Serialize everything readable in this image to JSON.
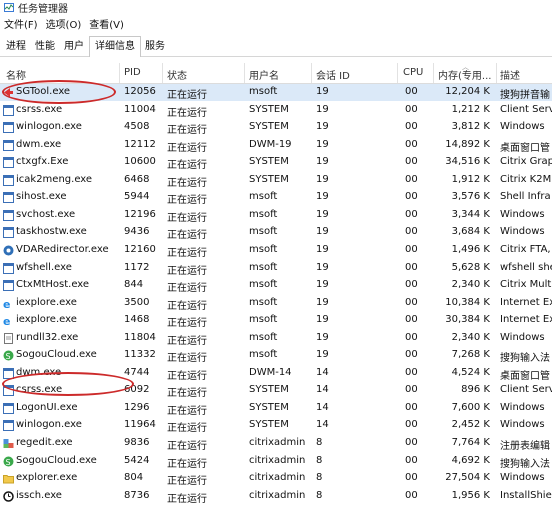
{
  "window": {
    "title": "任务管理器"
  },
  "menu": [
    "文件(F)",
    "选项(O)",
    "查看(V)"
  ],
  "tabs": [
    "进程",
    "性能",
    "用户",
    "详细信息",
    "服务"
  ],
  "columns": [
    "名称",
    "PID",
    "状态",
    "用户名",
    "会话 ID",
    "CPU",
    "内存(专用...",
    "描述"
  ],
  "rows": [
    {
      "name": "SGTool.exe",
      "pid": "12056",
      "status": "正在运行",
      "user": "msoft",
      "session": "19",
      "cpu": "00",
      "mem": "12,204 K",
      "desc": "搜狗拼音输",
      "icon": "red-arrow-icon"
    },
    {
      "name": "csrss.exe",
      "pid": "11004",
      "status": "正在运行",
      "user": "SYSTEM",
      "session": "19",
      "cpu": "00",
      "mem": "1,212 K",
      "desc": "Client Serv",
      "icon": "window-app-icon"
    },
    {
      "name": "winlogon.exe",
      "pid": "4508",
      "status": "正在运行",
      "user": "SYSTEM",
      "session": "19",
      "cpu": "00",
      "mem": "3,812 K",
      "desc": "Windows",
      "icon": "window-app-icon"
    },
    {
      "name": "dwm.exe",
      "pid": "12112",
      "status": "正在运行",
      "user": "DWM-19",
      "session": "19",
      "cpu": "00",
      "mem": "14,892 K",
      "desc": "桌面窗口管",
      "icon": "window-app-icon"
    },
    {
      "name": "ctxgfx.Exe",
      "pid": "10600",
      "status": "正在运行",
      "user": "SYSTEM",
      "session": "19",
      "cpu": "00",
      "mem": "34,516 K",
      "desc": "Citrix Grap",
      "icon": "window-app-icon"
    },
    {
      "name": "icak2meng.exe",
      "pid": "6468",
      "status": "正在运行",
      "user": "SYSTEM",
      "session": "19",
      "cpu": "00",
      "mem": "1,912 K",
      "desc": "Citrix K2M",
      "icon": "window-app-icon"
    },
    {
      "name": "sihost.exe",
      "pid": "5944",
      "status": "正在运行",
      "user": "msoft",
      "session": "19",
      "cpu": "00",
      "mem": "3,576 K",
      "desc": "Shell Infra",
      "icon": "window-app-icon"
    },
    {
      "name": "svchost.exe",
      "pid": "12196",
      "status": "正在运行",
      "user": "msoft",
      "session": "19",
      "cpu": "00",
      "mem": "3,344 K",
      "desc": "Windows",
      "icon": "window-app-icon"
    },
    {
      "name": "taskhostw.exe",
      "pid": "9436",
      "status": "正在运行",
      "user": "msoft",
      "session": "19",
      "cpu": "00",
      "mem": "3,684 K",
      "desc": "Windows",
      "icon": "window-app-icon"
    },
    {
      "name": "VDARedirector.exe",
      "pid": "12160",
      "status": "正在运行",
      "user": "msoft",
      "session": "19",
      "cpu": "00",
      "mem": "1,496 K",
      "desc": "Citrix FTA,",
      "icon": "citrix-icon"
    },
    {
      "name": "wfshell.exe",
      "pid": "1172",
      "status": "正在运行",
      "user": "msoft",
      "session": "19",
      "cpu": "00",
      "mem": "5,628 K",
      "desc": "wfshell she",
      "icon": "window-app-icon"
    },
    {
      "name": "CtxMtHost.exe",
      "pid": "844",
      "status": "正在运行",
      "user": "msoft",
      "session": "19",
      "cpu": "00",
      "mem": "2,340 K",
      "desc": "Citrix Mult",
      "icon": "window-app-icon"
    },
    {
      "name": "iexplore.exe",
      "pid": "3500",
      "status": "正在运行",
      "user": "msoft",
      "session": "19",
      "cpu": "00",
      "mem": "10,384 K",
      "desc": "Internet Ex",
      "icon": "ie-icon"
    },
    {
      "name": "iexplore.exe",
      "pid": "1468",
      "status": "正在运行",
      "user": "msoft",
      "session": "19",
      "cpu": "00",
      "mem": "30,384 K",
      "desc": "Internet Ex",
      "icon": "ie-icon"
    },
    {
      "name": "rundll32.exe",
      "pid": "11804",
      "status": "正在运行",
      "user": "msoft",
      "session": "19",
      "cpu": "00",
      "mem": "2,340 K",
      "desc": "Windows",
      "icon": "document-icon"
    },
    {
      "name": "SogouCloud.exe",
      "pid": "11332",
      "status": "正在运行",
      "user": "msoft",
      "session": "19",
      "cpu": "00",
      "mem": "7,268 K",
      "desc": "搜狗输入法",
      "icon": "sogou-icon"
    },
    {
      "name": "dwm.exe",
      "pid": "4744",
      "status": "正在运行",
      "user": "DWM-14",
      "session": "14",
      "cpu": "00",
      "mem": "4,524 K",
      "desc": "桌面窗口管",
      "icon": "window-app-icon"
    },
    {
      "name": "csrss.exe",
      "pid": "6092",
      "status": "正在运行",
      "user": "SYSTEM",
      "session": "14",
      "cpu": "00",
      "mem": "896 K",
      "desc": "Client Serv",
      "icon": "window-app-icon"
    },
    {
      "name": "LogonUI.exe",
      "pid": "1296",
      "status": "正在运行",
      "user": "SYSTEM",
      "session": "14",
      "cpu": "00",
      "mem": "7,600 K",
      "desc": "Windows",
      "icon": "window-app-icon"
    },
    {
      "name": "winlogon.exe",
      "pid": "11964",
      "status": "正在运行",
      "user": "SYSTEM",
      "session": "14",
      "cpu": "00",
      "mem": "2,452 K",
      "desc": "Windows",
      "icon": "window-app-icon"
    },
    {
      "name": "regedit.exe",
      "pid": "9836",
      "status": "正在运行",
      "user": "citrixadmin",
      "session": "8",
      "cpu": "00",
      "mem": "7,764 K",
      "desc": "注册表编辑",
      "icon": "regedit-icon"
    },
    {
      "name": "SogouCloud.exe",
      "pid": "5424",
      "status": "正在运行",
      "user": "citrixadmin",
      "session": "8",
      "cpu": "00",
      "mem": "4,692 K",
      "desc": "搜狗输入法",
      "icon": "sogou-icon"
    },
    {
      "name": "explorer.exe",
      "pid": "804",
      "status": "正在运行",
      "user": "citrixadmin",
      "session": "8",
      "cpu": "00",
      "mem": "27,504 K",
      "desc": "Windows",
      "icon": "folder-icon"
    },
    {
      "name": "issch.exe",
      "pid": "8736",
      "status": "正在运行",
      "user": "citrixadmin",
      "session": "8",
      "cpu": "00",
      "mem": "1,956 K",
      "desc": "InstallShie",
      "icon": "clock-icon"
    }
  ],
  "colors": {
    "selected_row": "#dbe9f8",
    "annotation": "#cc2a2a",
    "ie_blue": "#1e88e5",
    "sogou_green": "#3aa84a"
  }
}
